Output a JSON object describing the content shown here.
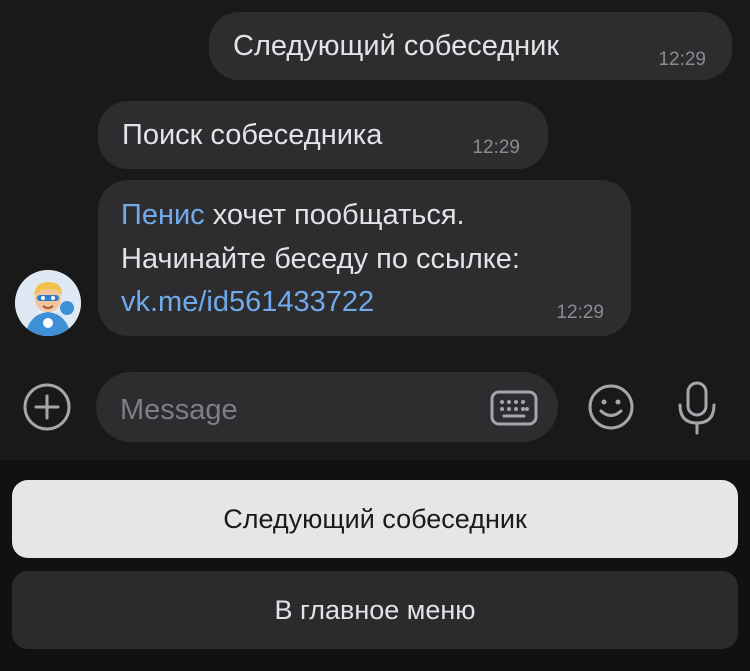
{
  "messages": [
    {
      "text": "Следующий собеседник",
      "time": "12:29"
    },
    {
      "text": "Поиск собеседника",
      "time": "12:29"
    },
    {
      "mention": "Пенис",
      "line1_rest": " хочет пообщаться.",
      "line2": "Начинайте беседу по ссылке:",
      "link": "vk.me/id561433722",
      "time": "12:29"
    }
  ],
  "composer": {
    "placeholder": "Message"
  },
  "keyboard": {
    "buttons": [
      "Следующий собеседник",
      "В главное меню"
    ]
  },
  "colors": {
    "link": "#71aaeb",
    "bubble": "#2d2d2f",
    "background": "#191919"
  }
}
